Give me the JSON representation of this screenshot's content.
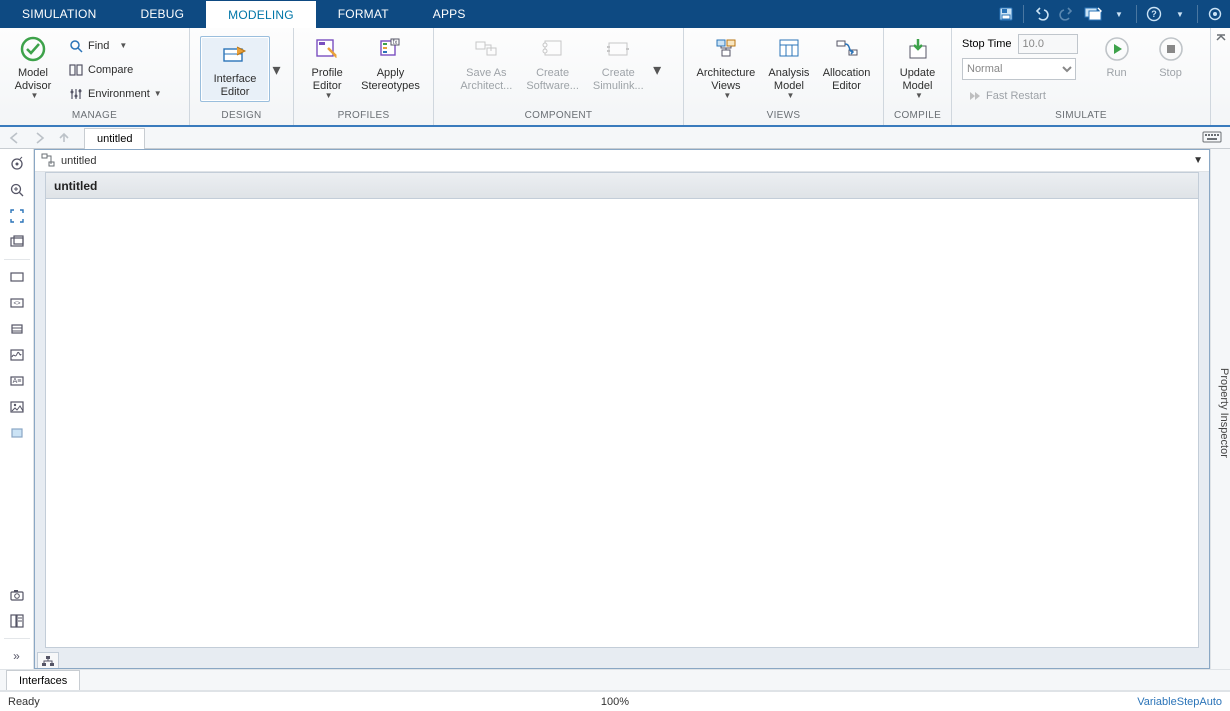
{
  "tabs": {
    "simulation": "SIMULATION",
    "debug": "DEBUG",
    "modeling": "MODELING",
    "format": "FORMAT",
    "apps": "APPS",
    "active": "modeling"
  },
  "qat": {
    "save": "save-icon",
    "undo": "undo-icon",
    "redo": "redo-icon",
    "switch": "switch-windows-icon",
    "help": "help-icon",
    "fullscreen": "fullscreen-icon"
  },
  "ribbon": {
    "manage": {
      "label": "MANAGE",
      "model_advisor": "Model\nAdvisor",
      "find": "Find",
      "compare": "Compare",
      "environment": "Environment"
    },
    "design": {
      "label": "DESIGN",
      "interface_editor": "Interface\nEditor"
    },
    "profiles": {
      "label": "PROFILES",
      "profile_editor": "Profile\nEditor",
      "apply_stereotypes": "Apply\nStereotypes"
    },
    "component": {
      "label": "COMPONENT",
      "save_as_architecture": "Save As\nArchitect...",
      "create_software": "Create\nSoftware...",
      "create_simulink": "Create\nSimulink..."
    },
    "views": {
      "label": "VIEWS",
      "architecture_views": "Architecture\nViews",
      "analysis_model": "Analysis\nModel",
      "allocation_editor": "Allocation\nEditor"
    },
    "compile": {
      "label": "COMPILE",
      "update_model": "Update\nModel"
    },
    "simulate": {
      "label": "SIMULATE",
      "stop_time_label": "Stop Time",
      "stop_time_value": "10.0",
      "mode": "Normal",
      "fast_restart": "Fast Restart",
      "run": "Run",
      "stop": "Stop"
    }
  },
  "nav": {
    "doc_tab": "untitled"
  },
  "path": {
    "model_name": "untitled"
  },
  "canvas": {
    "title": "untitled"
  },
  "right_panel": {
    "label": "Property Inspector"
  },
  "bottom_panel": {
    "tab": "Interfaces"
  },
  "status": {
    "left": "Ready",
    "center": "100%",
    "right": "VariableStepAuto"
  }
}
